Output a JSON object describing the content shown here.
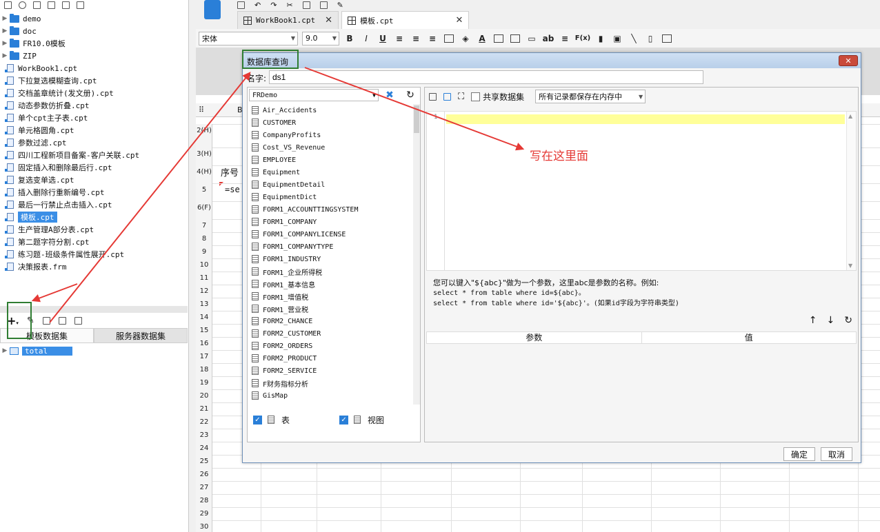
{
  "left_panel": {
    "tree_items": [
      {
        "type": "folder",
        "label": "demo"
      },
      {
        "type": "folder",
        "label": "doc"
      },
      {
        "type": "folder",
        "label": "FR10.0模板"
      },
      {
        "type": "folder",
        "label": "ZIP"
      },
      {
        "type": "file",
        "label": "WorkBook1.cpt"
      },
      {
        "type": "file",
        "label": "下拉复选模糊查询.cpt"
      },
      {
        "type": "file",
        "label": "交档盖章统计(发文册).cpt"
      },
      {
        "type": "file",
        "label": "动态参数仿折叠.cpt"
      },
      {
        "type": "file",
        "label": "单个cpt主子表.cpt"
      },
      {
        "type": "file",
        "label": "单元格圆角.cpt"
      },
      {
        "type": "file",
        "label": "参数过滤.cpt"
      },
      {
        "type": "file",
        "label": "四川工程新项目备案-客户关联.cpt"
      },
      {
        "type": "file",
        "label": "固定插入和删除最后行.cpt"
      },
      {
        "type": "file",
        "label": "复选变单选.cpt"
      },
      {
        "type": "file",
        "label": "插入删除行重新编号.cpt"
      },
      {
        "type": "file",
        "label": "最后一行禁止点击插入.cpt"
      },
      {
        "type": "file",
        "label": "模板.cpt",
        "selected": true
      },
      {
        "type": "file",
        "label": "生产管理A部分表.cpt"
      },
      {
        "type": "file",
        "label": "第二题字符分割.cpt"
      },
      {
        "type": "file",
        "label": "练习题-班级条件属性展开.cpt"
      },
      {
        "type": "file",
        "label": "决策报表.frm"
      }
    ],
    "dataset_tabs": [
      "模板数据集",
      "服务器数据集"
    ],
    "datasets": [
      {
        "label": "total",
        "selected": true
      }
    ]
  },
  "doc_tabs": [
    {
      "label": "WorkBook1.cpt",
      "active": false
    },
    {
      "label": "模板.cpt",
      "active": true
    }
  ],
  "format_bar": {
    "font": "宋体",
    "size": "9.0",
    "bold": "B",
    "italic": "I",
    "underline": "U",
    "ab": "ab",
    "fx": "F(x)"
  },
  "sheet": {
    "row_labels": [
      "2(H)",
      "3(H)",
      "4(H)",
      "5",
      "6(F)",
      "7",
      "8",
      "9",
      "10",
      "11",
      "12",
      "13",
      "14",
      "15",
      "16",
      "17",
      "18",
      "19",
      "20",
      "21",
      "22",
      "23",
      "24",
      "25",
      "26",
      "27",
      "28",
      "29",
      "30"
    ],
    "cell_seq": "序号",
    "cell_formula": "=se",
    "col_b": "B"
  },
  "dialog": {
    "title": "数据库查询",
    "close": "✕",
    "name_label": "名字:",
    "name_value": "ds1",
    "connection": "FRDemo",
    "tables": [
      "Air_Accidents",
      "CUSTOMER",
      "CompanyProfits",
      "Cost_VS_Revenue",
      "EMPLOYEE",
      "Equipment",
      "EquipmentDetail",
      "EquipmentDict",
      "FORM1_ACCOUNTTINGSYSTEM",
      "FORM1_COMPANY",
      "FORM1_COMPANYLICENSE",
      "FORM1_COMPANYTYPE",
      "FORM1_INDUSTRY",
      "FORM1_企业所得税",
      "FORM1_基本信息",
      "FORM1_增值税",
      "FORM1_营业税",
      "FORM2_CHANCE",
      "FORM2_CUSTOMER",
      "FORM2_ORDERS",
      "FORM2_PRODUCT",
      "FORM2_SERVICE",
      "F财务指标分析",
      "GisMap"
    ],
    "filter_table": "表",
    "filter_view": "视图",
    "share_dataset": "共享数据集",
    "cache_mode": "所有记录都保存在内存中",
    "line_number": "1",
    "hint_line1": "您可以键入\"${abc}\"做为一个参数，这里abc是参数的名称。例如:",
    "hint_line2": "select * from table where id=${abc}。",
    "hint_line3": "select * from table where id='${abc}'。(如果id字段为字符串类型)",
    "param_col": "参数",
    "value_col": "值",
    "ok": "确定",
    "cancel": "取消"
  },
  "annotation": {
    "text": "写在这里面",
    "arrow_color": "#e53935",
    "box_color": "#2f7d32"
  }
}
